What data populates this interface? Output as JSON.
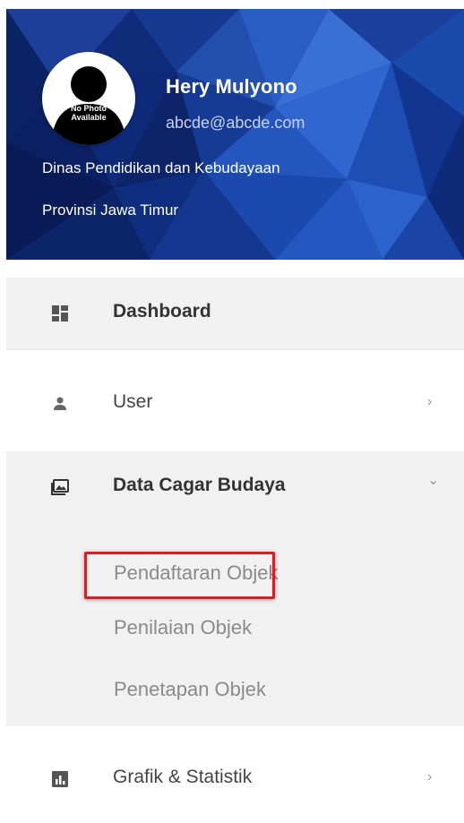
{
  "profile": {
    "avatar_caption": [
      "No Photo",
      "Available"
    ],
    "name": "Hery Mulyono",
    "email": "abcde@abcde.com",
    "organization_line1": "Dinas Pendidikan dan Kebudayaan",
    "organization_line2": "Provinsi Jawa Timur"
  },
  "menu": {
    "dashboard": {
      "label": "Dashboard",
      "icon": "dashboard-icon"
    },
    "user": {
      "label": "User",
      "icon": "person-icon",
      "chevron": "›"
    },
    "data_cagar_budaya": {
      "label": "Data Cagar Budaya",
      "icon": "photo-album-icon",
      "chevron": "⌄",
      "submenu": [
        "Pendaftaran Objek",
        "Penilaian Objek",
        "Penetapan Objek"
      ]
    },
    "grafik": {
      "label": "Grafik & Statistik",
      "icon": "chart-icon",
      "chevron": "›"
    }
  },
  "colors": {
    "header_bg": "#0a1f5c",
    "active_bg": "#f1f1f1",
    "highlight": "#d61e24"
  }
}
